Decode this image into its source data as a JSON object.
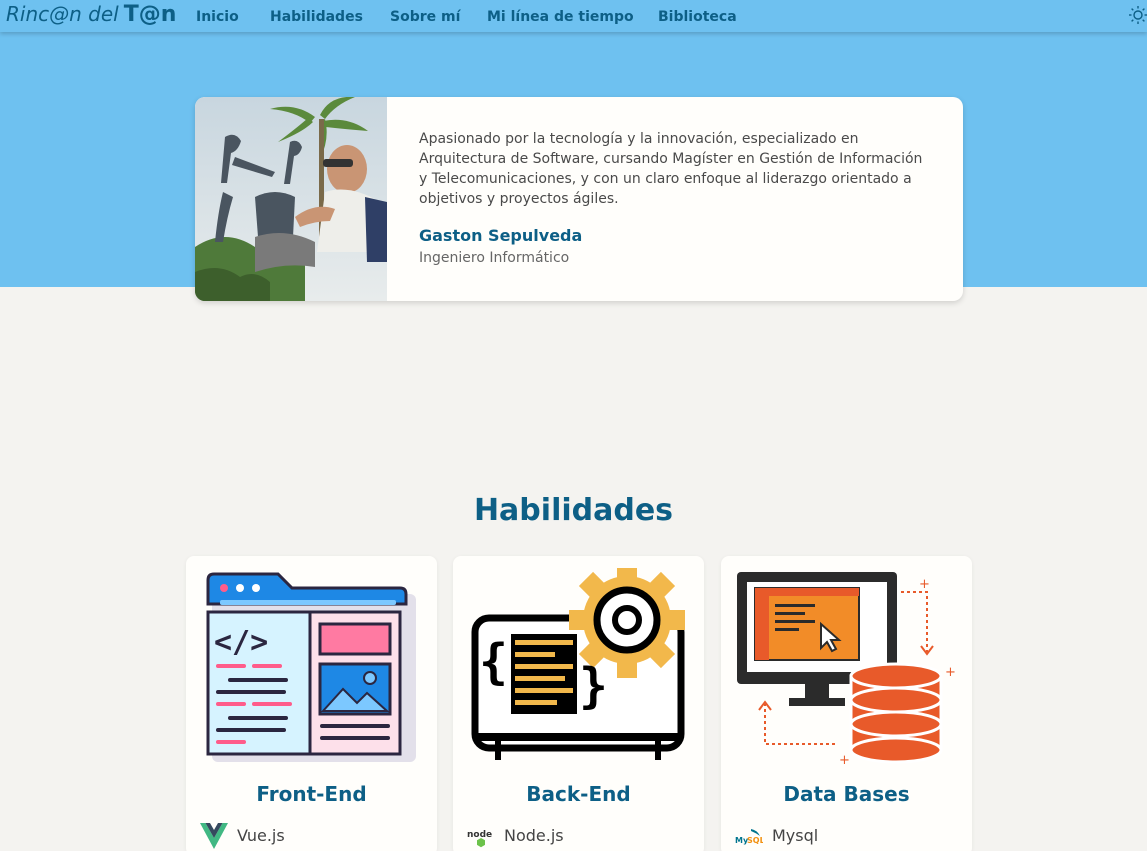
{
  "nav": {
    "brand_light": "Rinc@n del",
    "brand_bold": "T@n",
    "links": [
      "Inicio",
      "Habilidades",
      "Sobre mí",
      "Mi línea de tiempo",
      "Biblioteca"
    ],
    "theme_icon": "sun-icon"
  },
  "profile": {
    "bio": "Apasionado por la tecnología y la innovación, especializado en Arquitectura de Software, cursando Magíster en Gestión de Información y Telecomunicaciones, y con un claro enfoque al liderazgo orientado a objetivos y proyectos ágiles.",
    "name": "Gaston Sepulveda",
    "role": "Ingeniero Informático"
  },
  "skills": {
    "title": "Habilidades",
    "cards": [
      {
        "title": "Front-End",
        "tech": "Vue.js",
        "icon": "vue-icon"
      },
      {
        "title": "Back-End",
        "tech": "Node.js",
        "icon": "node-icon"
      },
      {
        "title": "Data Bases",
        "tech": "Mysql",
        "icon": "mysql-icon"
      }
    ]
  },
  "colors": {
    "primary": "#0d5f86",
    "hero": "#6ec1f0",
    "background": "#f4f3f0",
    "card": "#fffefb"
  }
}
